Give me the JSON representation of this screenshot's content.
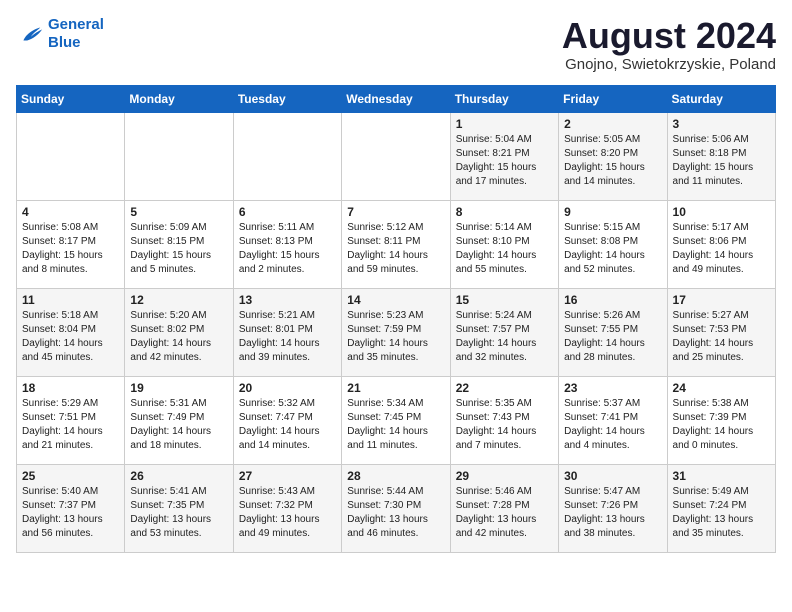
{
  "logo": {
    "line1": "General",
    "line2": "Blue"
  },
  "title": "August 2024",
  "location": "Gnojno, Swietokrzyskie, Poland",
  "days_of_week": [
    "Sunday",
    "Monday",
    "Tuesday",
    "Wednesday",
    "Thursday",
    "Friday",
    "Saturday"
  ],
  "weeks": [
    [
      {
        "day": "",
        "info": ""
      },
      {
        "day": "",
        "info": ""
      },
      {
        "day": "",
        "info": ""
      },
      {
        "day": "",
        "info": ""
      },
      {
        "day": "1",
        "info": "Sunrise: 5:04 AM\nSunset: 8:21 PM\nDaylight: 15 hours\nand 17 minutes."
      },
      {
        "day": "2",
        "info": "Sunrise: 5:05 AM\nSunset: 8:20 PM\nDaylight: 15 hours\nand 14 minutes."
      },
      {
        "day": "3",
        "info": "Sunrise: 5:06 AM\nSunset: 8:18 PM\nDaylight: 15 hours\nand 11 minutes."
      }
    ],
    [
      {
        "day": "4",
        "info": "Sunrise: 5:08 AM\nSunset: 8:17 PM\nDaylight: 15 hours\nand 8 minutes."
      },
      {
        "day": "5",
        "info": "Sunrise: 5:09 AM\nSunset: 8:15 PM\nDaylight: 15 hours\nand 5 minutes."
      },
      {
        "day": "6",
        "info": "Sunrise: 5:11 AM\nSunset: 8:13 PM\nDaylight: 15 hours\nand 2 minutes."
      },
      {
        "day": "7",
        "info": "Sunrise: 5:12 AM\nSunset: 8:11 PM\nDaylight: 14 hours\nand 59 minutes."
      },
      {
        "day": "8",
        "info": "Sunrise: 5:14 AM\nSunset: 8:10 PM\nDaylight: 14 hours\nand 55 minutes."
      },
      {
        "day": "9",
        "info": "Sunrise: 5:15 AM\nSunset: 8:08 PM\nDaylight: 14 hours\nand 52 minutes."
      },
      {
        "day": "10",
        "info": "Sunrise: 5:17 AM\nSunset: 8:06 PM\nDaylight: 14 hours\nand 49 minutes."
      }
    ],
    [
      {
        "day": "11",
        "info": "Sunrise: 5:18 AM\nSunset: 8:04 PM\nDaylight: 14 hours\nand 45 minutes."
      },
      {
        "day": "12",
        "info": "Sunrise: 5:20 AM\nSunset: 8:02 PM\nDaylight: 14 hours\nand 42 minutes."
      },
      {
        "day": "13",
        "info": "Sunrise: 5:21 AM\nSunset: 8:01 PM\nDaylight: 14 hours\nand 39 minutes."
      },
      {
        "day": "14",
        "info": "Sunrise: 5:23 AM\nSunset: 7:59 PM\nDaylight: 14 hours\nand 35 minutes."
      },
      {
        "day": "15",
        "info": "Sunrise: 5:24 AM\nSunset: 7:57 PM\nDaylight: 14 hours\nand 32 minutes."
      },
      {
        "day": "16",
        "info": "Sunrise: 5:26 AM\nSunset: 7:55 PM\nDaylight: 14 hours\nand 28 minutes."
      },
      {
        "day": "17",
        "info": "Sunrise: 5:27 AM\nSunset: 7:53 PM\nDaylight: 14 hours\nand 25 minutes."
      }
    ],
    [
      {
        "day": "18",
        "info": "Sunrise: 5:29 AM\nSunset: 7:51 PM\nDaylight: 14 hours\nand 21 minutes."
      },
      {
        "day": "19",
        "info": "Sunrise: 5:31 AM\nSunset: 7:49 PM\nDaylight: 14 hours\nand 18 minutes."
      },
      {
        "day": "20",
        "info": "Sunrise: 5:32 AM\nSunset: 7:47 PM\nDaylight: 14 hours\nand 14 minutes."
      },
      {
        "day": "21",
        "info": "Sunrise: 5:34 AM\nSunset: 7:45 PM\nDaylight: 14 hours\nand 11 minutes."
      },
      {
        "day": "22",
        "info": "Sunrise: 5:35 AM\nSunset: 7:43 PM\nDaylight: 14 hours\nand 7 minutes."
      },
      {
        "day": "23",
        "info": "Sunrise: 5:37 AM\nSunset: 7:41 PM\nDaylight: 14 hours\nand 4 minutes."
      },
      {
        "day": "24",
        "info": "Sunrise: 5:38 AM\nSunset: 7:39 PM\nDaylight: 14 hours\nand 0 minutes."
      }
    ],
    [
      {
        "day": "25",
        "info": "Sunrise: 5:40 AM\nSunset: 7:37 PM\nDaylight: 13 hours\nand 56 minutes."
      },
      {
        "day": "26",
        "info": "Sunrise: 5:41 AM\nSunset: 7:35 PM\nDaylight: 13 hours\nand 53 minutes."
      },
      {
        "day": "27",
        "info": "Sunrise: 5:43 AM\nSunset: 7:32 PM\nDaylight: 13 hours\nand 49 minutes."
      },
      {
        "day": "28",
        "info": "Sunrise: 5:44 AM\nSunset: 7:30 PM\nDaylight: 13 hours\nand 46 minutes."
      },
      {
        "day": "29",
        "info": "Sunrise: 5:46 AM\nSunset: 7:28 PM\nDaylight: 13 hours\nand 42 minutes."
      },
      {
        "day": "30",
        "info": "Sunrise: 5:47 AM\nSunset: 7:26 PM\nDaylight: 13 hours\nand 38 minutes."
      },
      {
        "day": "31",
        "info": "Sunrise: 5:49 AM\nSunset: 7:24 PM\nDaylight: 13 hours\nand 35 minutes."
      }
    ]
  ]
}
